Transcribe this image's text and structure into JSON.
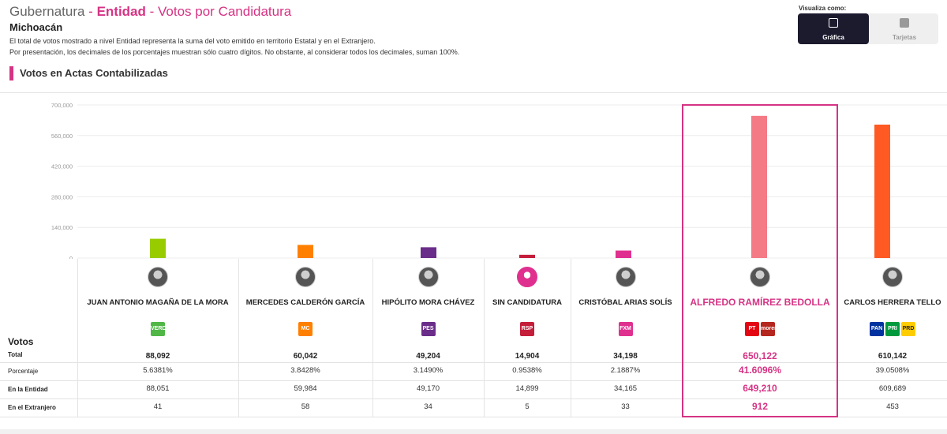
{
  "header": {
    "title_part1": "Gubernatura",
    "title_sep1": " - ",
    "title_part2": "Entidad",
    "title_sep2": " - ",
    "title_part3": "Votos por Candidatura",
    "state": "Michoacán",
    "note1": "El total de votos mostrado a nivel Entidad representa la suma del voto emitido en territorio Estatal y en el Extranjero.",
    "note2": "Por presentación, los decimales de los porcentajes muestran sólo cuatro dígitos. No obstante, al considerar todos los decimales, suman 100%.",
    "section_title": "Votos en Actas Contabilizadas"
  },
  "view_toggle": {
    "label": "Visualiza como:",
    "options": [
      {
        "label": "Gráfica",
        "icon": "bar-chart-icon",
        "selected": true
      },
      {
        "label": "Tarjetas",
        "icon": "grid-icon",
        "selected": false
      }
    ]
  },
  "table_labels": {
    "votos": "Votos",
    "total": "Total",
    "porcentaje": "Porcentaje",
    "entidad": "En la Entidad",
    "extranjero": "En el Extranjero"
  },
  "candidates": [
    {
      "name": "JUAN ANTONIO MAGAÑA DE LA MORA",
      "parties": [
        "VERDE"
      ],
      "total": "88,092",
      "pct": "5.6381%",
      "entidad": "88,051",
      "extranjero": "41"
    },
    {
      "name": "MERCEDES CALDERÓN GARCÍA",
      "parties": [
        "MC"
      ],
      "total": "60,042",
      "pct": "3.8428%",
      "entidad": "59,984",
      "extranjero": "58"
    },
    {
      "name": "HIPÓLITO MORA CHÁVEZ",
      "parties": [
        "PES"
      ],
      "total": "49,204",
      "pct": "3.1490%",
      "entidad": "49,170",
      "extranjero": "34"
    },
    {
      "name": "SIN CANDIDATURA",
      "parties": [
        "RSP"
      ],
      "total": "14,904",
      "pct": "0.9538%",
      "entidad": "14,899",
      "extranjero": "5"
    },
    {
      "name": "CRISTÓBAL ARIAS SOLÍS",
      "parties": [
        "FXM"
      ],
      "total": "34,198",
      "pct": "2.1887%",
      "entidad": "34,165",
      "extranjero": "33"
    },
    {
      "name": "ALFREDO RAMÍREZ BEDOLLA",
      "parties": [
        "PT",
        "morena"
      ],
      "total": "650,122",
      "pct": "41.6096%",
      "entidad": "649,210",
      "extranjero": "912"
    },
    {
      "name": "CARLOS HERRERA TELLO",
      "parties": [
        "PAN",
        "PRI",
        "PRD"
      ],
      "total": "610,142",
      "pct": "39.0508%",
      "entidad": "609,689",
      "extranjero": "453"
    }
  ],
  "chart_data": {
    "type": "bar",
    "categories": [
      "JUAN ANTONIO MAGAÑA DE LA MORA",
      "MERCEDES CALDERÓN GARCÍA",
      "HIPÓLITO MORA CHÁVEZ",
      "SIN CANDIDATURA",
      "CRISTÓBAL ARIAS SOLÍS",
      "ALFREDO RAMÍREZ BEDOLLA",
      "CARLOS HERRERA TELLO"
    ],
    "values": [
      88092,
      60042,
      49204,
      14904,
      34198,
      650122,
      610142
    ],
    "colors": [
      "#99cc00",
      "#ff8000",
      "#6b2d8a",
      "#c41e3a",
      "#e0308f",
      "#f47a86",
      "#ff5a24"
    ],
    "ylim": [
      0,
      700000
    ],
    "yticks": [
      "0",
      "140,000",
      "280,000",
      "420,000",
      "560,000",
      "700,000"
    ],
    "grid": true
  },
  "party_colors": {
    "VERDE": "#50b747",
    "MC": "#ff8000",
    "PES": "#6b2d8a",
    "RSP": "#c41e3a",
    "FXM": "#e0308f",
    "PT": "#e30613",
    "morena": "#b5261e",
    "PAN": "#0033a0",
    "PRI": "#009a3e",
    "PRD": "#ffcc00"
  }
}
